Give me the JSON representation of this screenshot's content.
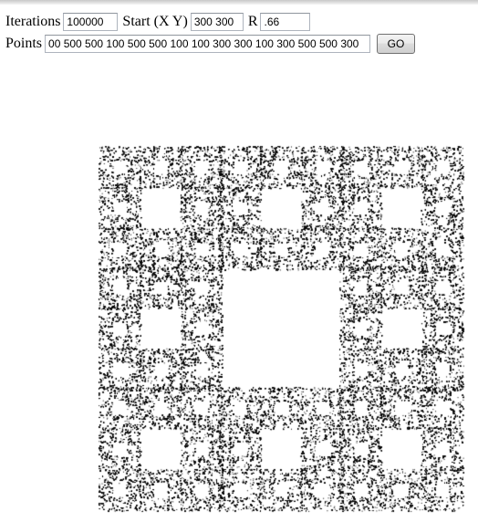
{
  "form": {
    "iterations_label": "Iterations",
    "iterations_value": "100000",
    "start_label": "Start (X Y)",
    "start_value": "300 300",
    "r_label": "R",
    "r_value": ".66",
    "points_label": "Points",
    "points_value": "00 500 500 100 500 500 100 100 300 300 100 300 500 500 300",
    "go_label": "GO"
  },
  "canvas": {
    "point_color": "#000000",
    "background": "#ffffff"
  }
}
